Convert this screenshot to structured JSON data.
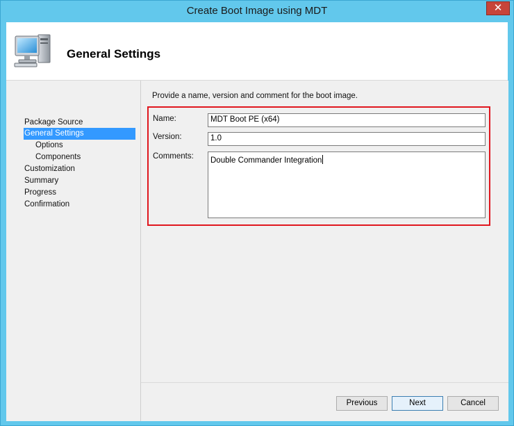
{
  "window": {
    "title": "Create Boot Image using MDT",
    "close_glyph": "✕"
  },
  "header": {
    "title": "General Settings",
    "icon": "computer-icon"
  },
  "nav": {
    "items": [
      {
        "label": "Package Source",
        "selected": false,
        "indent": 0
      },
      {
        "label": "General Settings",
        "selected": true,
        "indent": 0
      },
      {
        "label": "Options",
        "selected": false,
        "indent": 1
      },
      {
        "label": "Components",
        "selected": false,
        "indent": 1
      },
      {
        "label": "Customization",
        "selected": false,
        "indent": 0
      },
      {
        "label": "Summary",
        "selected": false,
        "indent": 0
      },
      {
        "label": "Progress",
        "selected": false,
        "indent": 0
      },
      {
        "label": "Confirmation",
        "selected": false,
        "indent": 0
      }
    ]
  },
  "content": {
    "description": "Provide a name, version and comment for the boot image.",
    "name_label": "Name:",
    "name_value": "MDT Boot PE (x64)",
    "version_label": "Version:",
    "version_value": "1.0",
    "comments_label": "Comments:",
    "comments_value": "Double Commander Integration"
  },
  "buttons": {
    "previous": "Previous",
    "next": "Next",
    "cancel": "Cancel"
  },
  "colors": {
    "titlebar": "#62c8ec",
    "selection": "#3399ff",
    "highlight_box": "#e0161e",
    "close_button": "#c7453a"
  }
}
